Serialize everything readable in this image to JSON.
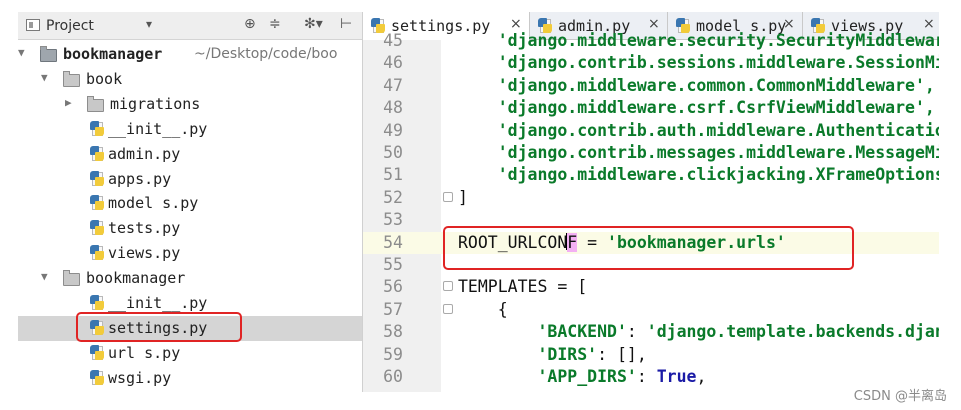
{
  "project_panel": {
    "title": "Project",
    "dropdown_glyph": "▾",
    "header_buttons": [
      "⊕",
      "≑",
      "✻▾",
      "⊢"
    ],
    "icons": {
      "header": "project-icon",
      "folder": "folder-icon",
      "python": "python-file-icon"
    },
    "tree": [
      {
        "label": "bookmanager",
        "path": "~/Desktop/code/boo",
        "type": "project-folder",
        "expanded": true,
        "indent": 0
      },
      {
        "label": "book",
        "type": "folder",
        "expanded": true,
        "indent": 1
      },
      {
        "label": "migrations",
        "type": "folder",
        "expanded": false,
        "indent": 2
      },
      {
        "label": "__init__.py",
        "type": "python",
        "indent": 3
      },
      {
        "label": "admin.py",
        "type": "python",
        "indent": 3
      },
      {
        "label": "apps.py",
        "type": "python",
        "indent": 3
      },
      {
        "label": "model s.py",
        "type": "python",
        "indent": 3
      },
      {
        "label": "tests.py",
        "type": "python",
        "indent": 3
      },
      {
        "label": "views.py",
        "type": "python",
        "indent": 3
      },
      {
        "label": "bookmanager",
        "type": "folder",
        "expanded": true,
        "indent": 1
      },
      {
        "label": "__init__.py",
        "type": "python",
        "indent": 3
      },
      {
        "label": "settings.py",
        "type": "python",
        "indent": 3,
        "selected": true
      },
      {
        "label": "url s.py",
        "type": "python",
        "indent": 3
      },
      {
        "label": "wsgi.py",
        "type": "python",
        "indent": 3
      }
    ]
  },
  "editor": {
    "tabs": [
      {
        "label": "settings.py",
        "active": true,
        "close": "×"
      },
      {
        "label": "admin.py",
        "active": false,
        "close": "×"
      },
      {
        "label": "model s.py",
        "active": false,
        "close": "×"
      },
      {
        "label": "views.py",
        "active": false,
        "close": "×"
      }
    ],
    "lines": [
      {
        "n": "45",
        "indent": "    ",
        "parts": [
          {
            "t": "'django.middleware.security.SecurityMiddleware',",
            "c": "s"
          }
        ]
      },
      {
        "n": "46",
        "indent": "    ",
        "parts": [
          {
            "t": "'django.contrib.sessions.middleware.SessionMiddleware',",
            "c": "s"
          }
        ]
      },
      {
        "n": "47",
        "indent": "    ",
        "parts": [
          {
            "t": "'django.middleware.common.CommonMiddleware',",
            "c": "s"
          }
        ]
      },
      {
        "n": "48",
        "indent": "    ",
        "parts": [
          {
            "t": "'django.middleware.csrf.CsrfViewMiddleware',",
            "c": "s"
          }
        ]
      },
      {
        "n": "49",
        "indent": "    ",
        "parts": [
          {
            "t": "'django.contrib.auth.middleware.AuthenticationMiddleware',",
            "c": "s"
          }
        ]
      },
      {
        "n": "50",
        "indent": "    ",
        "parts": [
          {
            "t": "'django.contrib.messages.middleware.MessageMiddleware',",
            "c": "s"
          }
        ]
      },
      {
        "n": "51",
        "indent": "    ",
        "parts": [
          {
            "t": "'django.middleware.clickjacking.XFrameOptionsMiddleware',",
            "c": "s"
          }
        ]
      },
      {
        "n": "52",
        "indent": "",
        "fold": true,
        "parts": [
          {
            "t": "]",
            "c": ""
          }
        ]
      },
      {
        "n": "53",
        "indent": "",
        "parts": []
      },
      {
        "n": "54",
        "indent": "",
        "current": true,
        "parts": [
          {
            "t": "ROOT_URLCON",
            "c": ""
          },
          {
            "t": "F",
            "c": "f"
          },
          {
            "t": " = ",
            "c": ""
          },
          {
            "t": "'bookmanager.urls'",
            "c": "s"
          }
        ]
      },
      {
        "n": "55",
        "indent": "",
        "parts": []
      },
      {
        "n": "56",
        "indent": "",
        "fold": true,
        "parts": [
          {
            "t": "TEMPLATES = [",
            "c": ""
          }
        ]
      },
      {
        "n": "57",
        "indent": "    ",
        "fold": true,
        "parts": [
          {
            "t": "{",
            "c": ""
          }
        ]
      },
      {
        "n": "58",
        "indent": "        ",
        "parts": [
          {
            "t": "'BACKEND'",
            "c": "s"
          },
          {
            "t": ": ",
            "c": ""
          },
          {
            "t": "'django.template.backends.django.DjangoTemplates',",
            "c": "s"
          }
        ]
      },
      {
        "n": "59",
        "indent": "        ",
        "parts": [
          {
            "t": "'DIRS'",
            "c": "s"
          },
          {
            "t": ": [],",
            "c": ""
          }
        ]
      },
      {
        "n": "60",
        "indent": "        ",
        "parts": [
          {
            "t": "'APP_DIRS'",
            "c": "s"
          },
          {
            "t": ": ",
            "c": ""
          },
          {
            "t": "True",
            "c": "k"
          },
          {
            "t": ",",
            "c": ""
          }
        ]
      }
    ]
  },
  "annotations": {
    "highlight_color": "#e02424"
  },
  "watermark": "CSDN @半离岛"
}
